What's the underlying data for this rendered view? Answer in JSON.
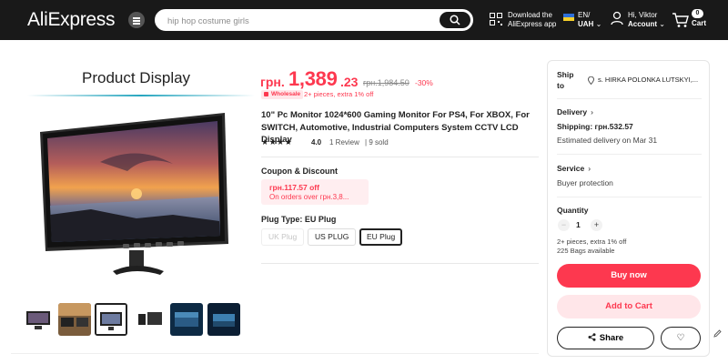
{
  "header": {
    "logo": "AliExpress",
    "search_placeholder": "hip hop costume girls",
    "app_line1": "Download the",
    "app_line2": "AliExpress app",
    "lang_line1": "EN/",
    "lang_line2": "UAH",
    "greeting": "Hi, Viktor",
    "account_label": "Account",
    "cart_count": "0",
    "cart_label": "Cart"
  },
  "gallery": {
    "title": "Product Display",
    "thumbnails": [
      "thumb-1",
      "thumb-2",
      "thumb-3",
      "thumb-4",
      "thumb-5",
      "thumb-6"
    ],
    "selected_index": 2
  },
  "product": {
    "currency": "грн.",
    "price_main": "1,389",
    "price_cents": ".23",
    "price_old": "грн.1,984.50",
    "discount": "-30%",
    "wholesale_badge": "Wholesale",
    "wholesale_note": "2+ pieces, extra 1% off",
    "title": "10\" Pc Monitor 1024*600 Gaming Monitor For PS4, For XBOX, For SWITCH, Automotive, Industrial Computers System CCTV LCD Display",
    "stars": "★★★★",
    "rating": "4.0",
    "reviews": "1 Review",
    "sold": "9 sold"
  },
  "coupon": {
    "heading": "Coupon & Discount",
    "amount": "грн.117.57 off",
    "condition": "On orders over грн.3,8..."
  },
  "plug": {
    "heading": "Plug Type: EU Plug",
    "options": [
      "UK Plug",
      "US PLUG",
      "EU Plug"
    ],
    "selected": "EU Plug"
  },
  "panel": {
    "ship_label_1": "Ship",
    "ship_label_2": "to",
    "ship_to": "s. HIRKA POLONKA LUTSKYI,...",
    "delivery_heading": "Delivery",
    "shipping": "Shipping: грн.532.57",
    "estimated": "Estimated delivery on Mar 31",
    "service_heading": "Service",
    "service_item": "Buyer protection",
    "quantity_heading": "Quantity",
    "quantity": "1",
    "qty_note_1": "2+ pieces, extra 1% off",
    "qty_note_2": "225 Bags available",
    "buy_now": "Buy now",
    "add_to_cart": "Add to Cart",
    "share": "Share"
  },
  "colors": {
    "accent": "#fd384f",
    "header_bg": "#191919",
    "accent_light": "#ffe6e9"
  }
}
